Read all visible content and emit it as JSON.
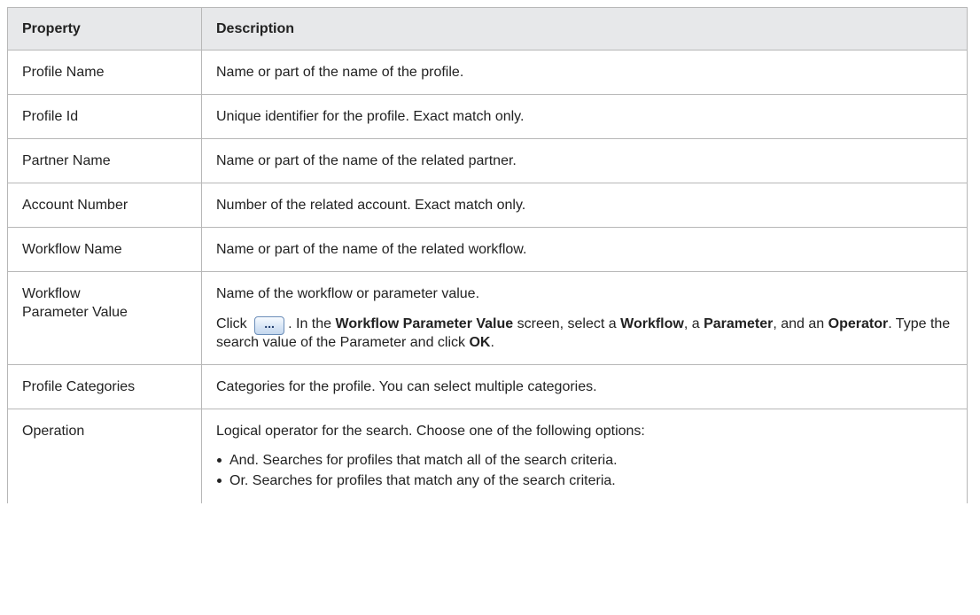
{
  "table": {
    "headers": {
      "property": "Property",
      "description": "Description"
    },
    "rows": [
      {
        "property": "Profile Name",
        "description": "Name or part of the name of the profile."
      },
      {
        "property": "Profile Id",
        "description": "Unique identifier for the profile. Exact match only."
      },
      {
        "property": "Partner Name",
        "description": "Name or part of the name of the related partner."
      },
      {
        "property": "Account Number",
        "description": "Number of the related account. Exact match only."
      },
      {
        "property": "Workflow Name",
        "description": "Name or part of the name of the related workflow."
      },
      {
        "property": "Workflow Parameter Value",
        "description": "Name of the workflow or parameter value.",
        "details": {
          "click": "Click",
          "button_icon": "ellipsis-icon",
          "button_label": "...",
          "t1": ". In the ",
          "b1": "Workflow Parameter Value",
          "t2": " screen, select a ",
          "b2": "Workflow",
          "t3": ", a ",
          "b3": "Parameter",
          "t4": ", and an ",
          "b4": "Operator",
          "t5": ". Type the search value of the Parameter and click ",
          "b5": "OK",
          "t6": "."
        }
      },
      {
        "property": "Profile Categories",
        "description": "Categories for the profile. You can select multiple categories."
      },
      {
        "property": "Operation",
        "description": "Logical operator for the search. Choose one of the following options:",
        "options": [
          "And. Searches for profiles that match all of the search criteria.",
          "Or. Searches for profiles that match any of the search criteria."
        ]
      }
    ]
  },
  "colors": {
    "header_bg": "#e7e8ea",
    "border": "#b7b7b7",
    "text": "#222222"
  }
}
